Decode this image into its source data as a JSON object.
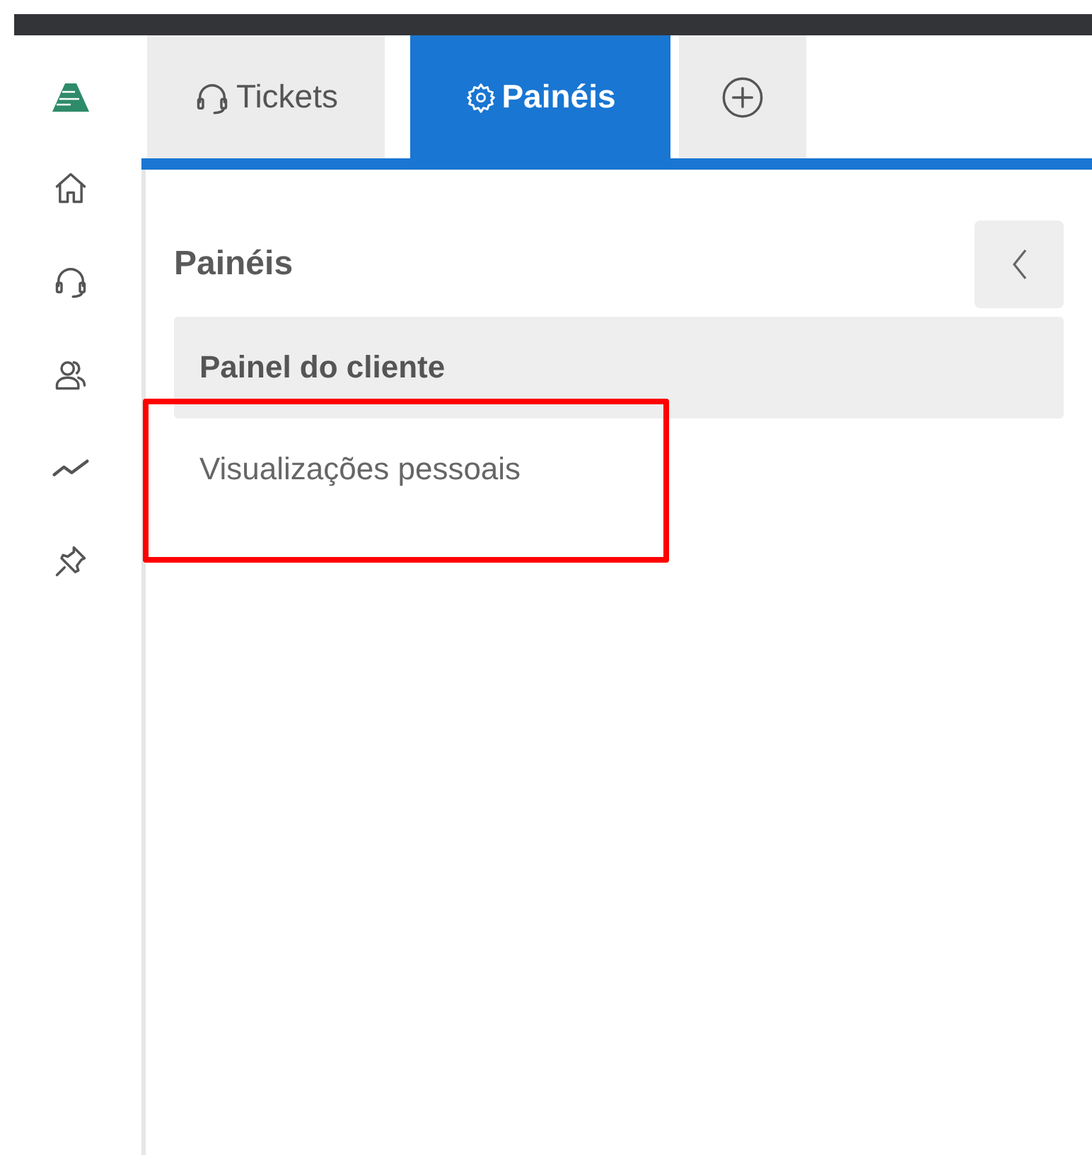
{
  "tabs": [
    {
      "kind": "tickets",
      "label": "Tickets",
      "selected": false
    },
    {
      "kind": "panels",
      "label": "Painéis",
      "selected": true
    },
    {
      "kind": "add",
      "selected": false
    }
  ],
  "sidebar": {
    "items": [
      {
        "kind": "home"
      },
      {
        "kind": "headset"
      },
      {
        "kind": "users"
      },
      {
        "kind": "chart"
      },
      {
        "kind": "pin"
      }
    ]
  },
  "panel": {
    "title": "Painéis",
    "items": [
      {
        "label": "Painel do cliente",
        "selected": true,
        "highlighted": false
      },
      {
        "label": "Visualizações pessoais",
        "selected": false,
        "highlighted": true
      }
    ]
  }
}
